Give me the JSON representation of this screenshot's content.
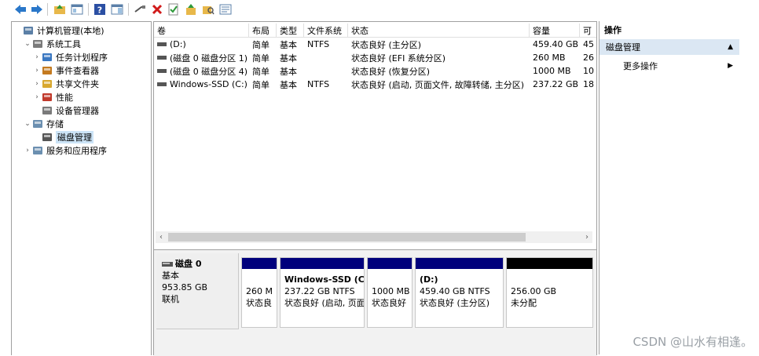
{
  "toolbar": {
    "buttons": [
      "back-icon",
      "forward-icon",
      "up-folder-icon",
      "console-tree-icon",
      "help-icon",
      "action-pane-icon",
      "connect-icon",
      "delete-icon",
      "check-icon",
      "import-icon",
      "search-folder-icon",
      "properties-icon"
    ]
  },
  "tree": {
    "items": [
      {
        "label": "计算机管理(本地)",
        "icon": "computer-management-icon",
        "level": 0,
        "arrow": ""
      },
      {
        "label": "系统工具",
        "icon": "system-tools-icon",
        "level": 1,
        "arrow": "⌄"
      },
      {
        "label": "任务计划程序",
        "icon": "clock-icon",
        "level": 2,
        "arrow": "›"
      },
      {
        "label": "事件查看器",
        "icon": "event-viewer-icon",
        "level": 2,
        "arrow": "›"
      },
      {
        "label": "共享文件夹",
        "icon": "shared-folder-icon",
        "level": 2,
        "arrow": "›"
      },
      {
        "label": "性能",
        "icon": "performance-icon",
        "level": 2,
        "arrow": "›"
      },
      {
        "label": "设备管理器",
        "icon": "device-manager-icon",
        "level": 2,
        "arrow": ""
      },
      {
        "label": "存储",
        "icon": "storage-icon",
        "level": 1,
        "arrow": "⌄"
      },
      {
        "label": "磁盘管理",
        "icon": "disk-icon",
        "level": 2,
        "arrow": "",
        "selected": true
      },
      {
        "label": "服务和应用程序",
        "icon": "services-icon",
        "level": 1,
        "arrow": "›"
      }
    ]
  },
  "volumes": {
    "columns": [
      "卷",
      "布局",
      "类型",
      "文件系统",
      "状态",
      "容量",
      "可"
    ],
    "rows": [
      {
        "name": "(D:)",
        "layout": "简单",
        "type": "基本",
        "fs": "NTFS",
        "status": "状态良好 (主分区)",
        "capacity": "459.40 GB",
        "free": "45"
      },
      {
        "name": "(磁盘 0 磁盘分区 1)",
        "layout": "简单",
        "type": "基本",
        "fs": "",
        "status": "状态良好 (EFI 系统分区)",
        "capacity": "260 MB",
        "free": "26"
      },
      {
        "name": "(磁盘 0 磁盘分区 4)",
        "layout": "简单",
        "type": "基本",
        "fs": "",
        "status": "状态良好 (恢复分区)",
        "capacity": "1000 MB",
        "free": "10"
      },
      {
        "name": "Windows-SSD (C:)",
        "layout": "简单",
        "type": "基本",
        "fs": "NTFS",
        "status": "状态良好 (启动, 页面文件, 故障转储, 主分区)",
        "capacity": "237.22 GB",
        "free": "18"
      }
    ]
  },
  "disk": {
    "name": "磁盘 0",
    "type": "基本",
    "size": "953.85 GB",
    "state": "联机",
    "partitions": [
      {
        "line1": "",
        "line2": "260 M",
        "line3": "状态良",
        "color": "#00007c"
      },
      {
        "line1": "Windows-SSD (C",
        "line2": "237.22 GB NTFS",
        "line3": "状态良好 (启动, 页面",
        "color": "#00007c"
      },
      {
        "line1": "",
        "line2": "1000 MB",
        "line3": "状态良好",
        "color": "#00007c"
      },
      {
        "line1": "(D:)",
        "line2": "459.40 GB NTFS",
        "line3": "状态良好 (主分区)",
        "color": "#00007c"
      },
      {
        "line1": "",
        "line2": "256.00 GB",
        "line3": "未分配",
        "color": "#000000"
      }
    ]
  },
  "actions": {
    "header": "操作",
    "section": "磁盘管理",
    "more": "更多操作"
  },
  "watermark": "CSDN @山水有相逢。"
}
